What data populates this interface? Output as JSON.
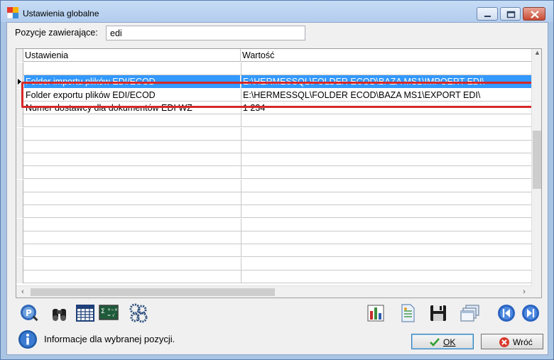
{
  "window": {
    "title": "Ustawienia globalne"
  },
  "filter": {
    "label": "Pozycje zawierające:",
    "value": "edi"
  },
  "grid": {
    "columns": [
      "Ustawienia",
      "Wartość"
    ],
    "rows": [
      {
        "setting": "",
        "value": ""
      },
      {
        "setting": "Folder importu plików EDI/ECOD",
        "value": "E:\\HERMESSQL\\FOLDER ECOD\\BAZA MS1\\IMPOERT EDI\\"
      },
      {
        "setting": "Folder exportu plików EDI/ECOD",
        "value": "E:\\HERMESSQL\\FOLDER ECOD\\BAZA MS1\\EXPORT EDI\\"
      },
      {
        "setting": "Numer dostawcy dla dokumentów EDI WZ",
        "value": "1 234"
      }
    ],
    "selected_row": 1
  },
  "toolbar": {
    "left_icons": [
      "search-page-icon",
      "binoculars-icon",
      "table-grid-icon",
      "formula-icon",
      "gears-icon"
    ],
    "right_icons": [
      "chart-icon",
      "document-icon",
      "save-icon",
      "windows-icon",
      "prev-icon",
      "next-icon"
    ]
  },
  "info": {
    "text": "Informacje dla wybranej pozycji."
  },
  "buttons": {
    "ok_label": "OK",
    "back_label": "Wróć"
  },
  "colors": {
    "selection": "#3399ff",
    "highlight": "#d62828",
    "accent": "#1e5aa8"
  }
}
